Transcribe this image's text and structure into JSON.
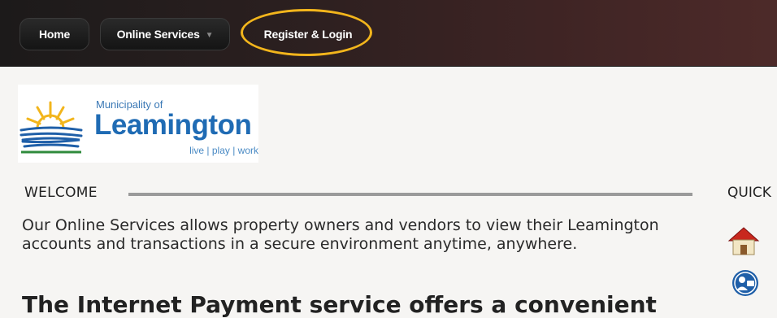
{
  "nav": {
    "home_label": "Home",
    "online_services_label": "Online Services",
    "register_login_label": "Register & Login"
  },
  "logo": {
    "small_text": "Municipality of",
    "name": "Leamington",
    "tagline": "live | play | work"
  },
  "welcome": {
    "heading": "WELCOME",
    "body": "Our Online Services allows property owners and vendors to view their Leamington accounts and transactions in a secure environment anytime, anywhere.",
    "next_heading": "The Internet Payment service offers a convenient"
  },
  "quick": {
    "heading": "QUICK"
  },
  "icons": {
    "quick_links": [
      "home-icon",
      "user-account-icon"
    ],
    "dropdown": "chevron-down-icon"
  },
  "colors": {
    "highlight": "#f2b51c",
    "brand_blue": "#1f6bb4"
  }
}
